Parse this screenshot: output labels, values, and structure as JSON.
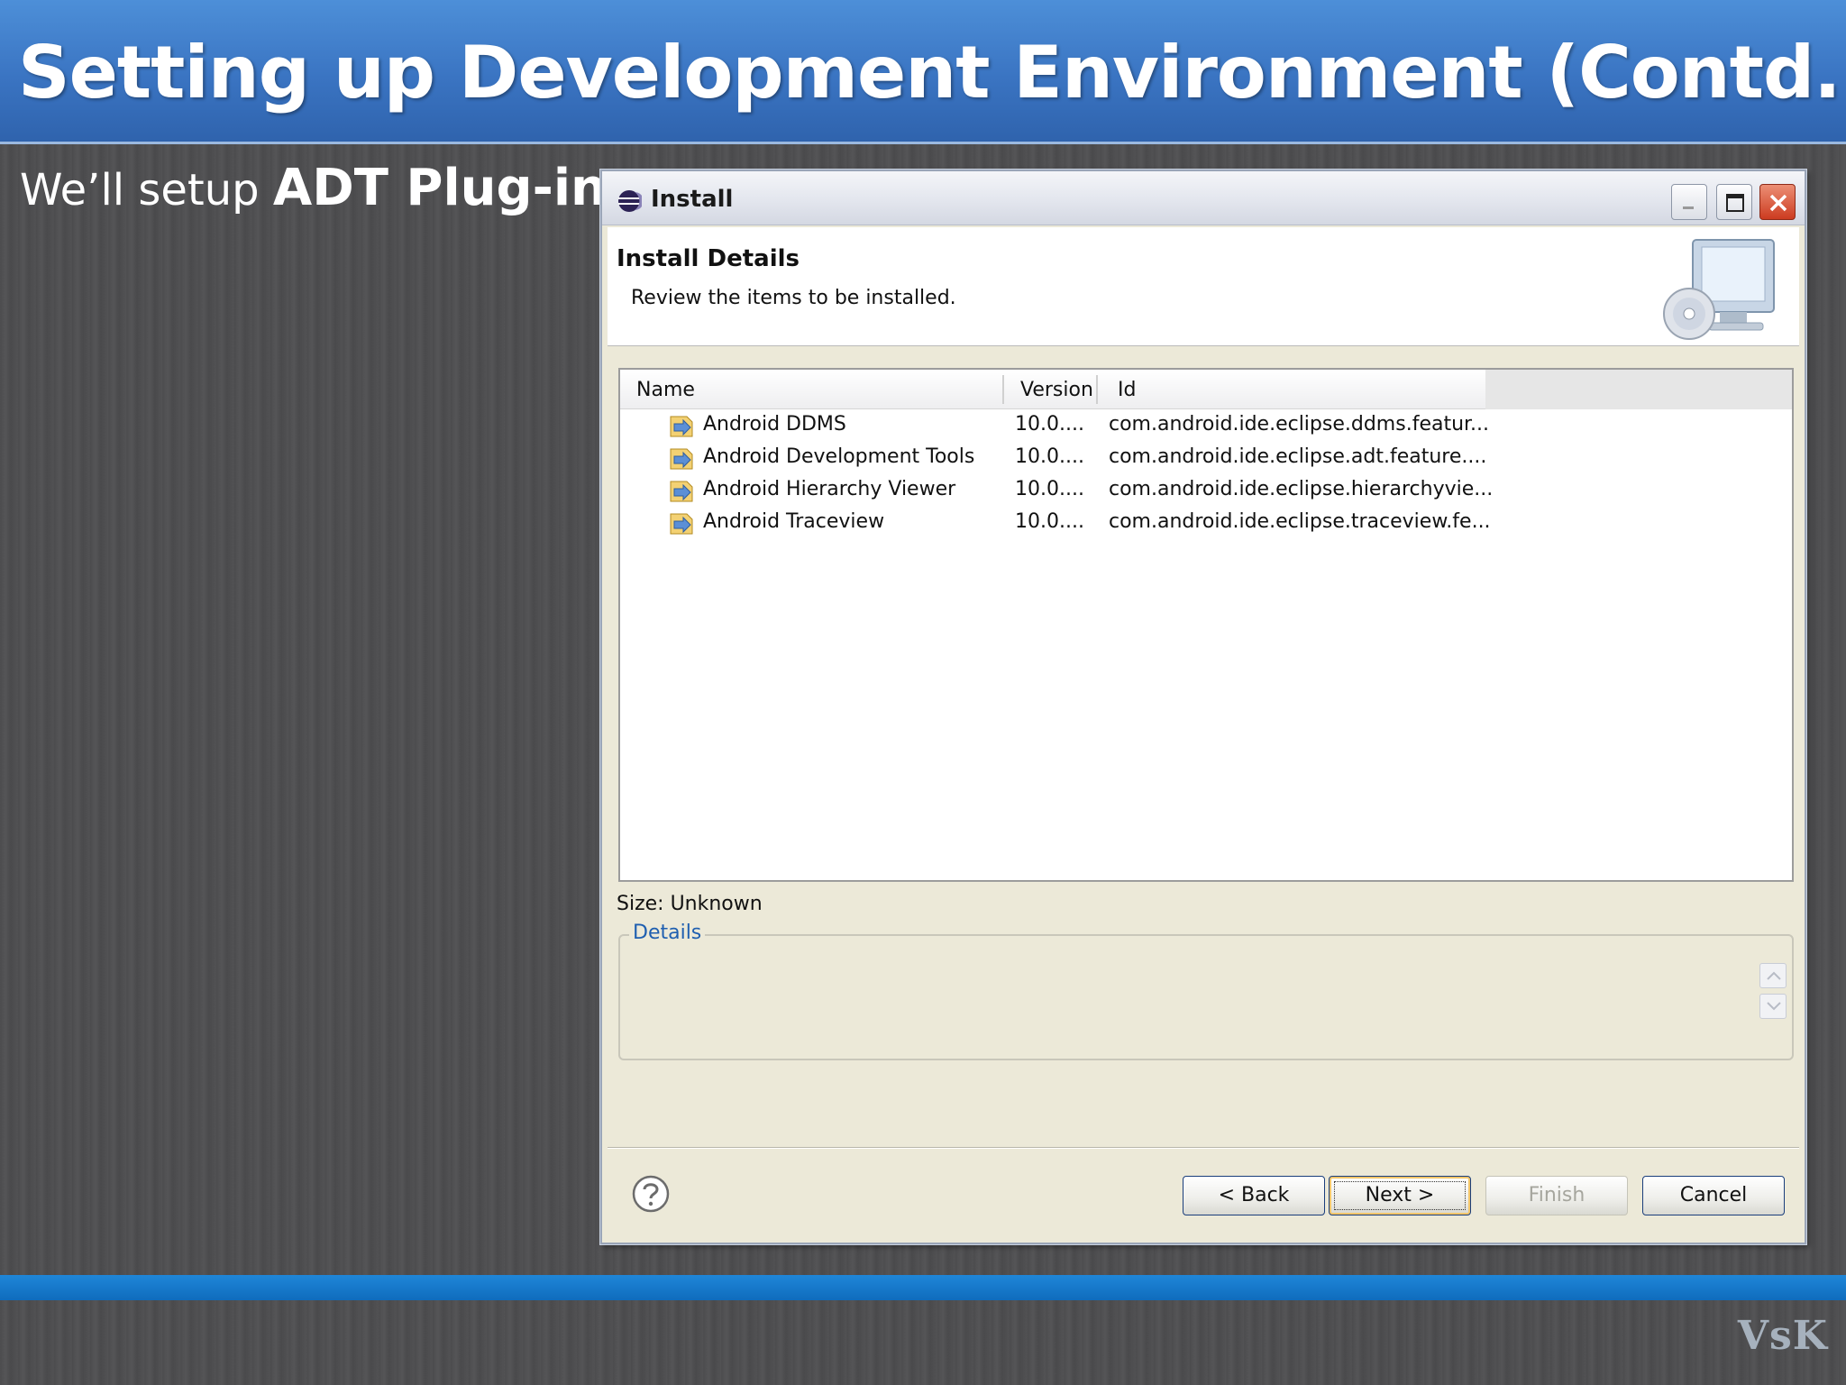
{
  "slide": {
    "title": "Setting up Development Environment (Contd.)",
    "subtitle_prefix": "We’ll setup ",
    "subtitle_bold": "ADT Plug-in",
    "watermark": "VsK"
  },
  "window": {
    "title": "Install",
    "header": {
      "heading": "Install Details",
      "description": "Review the items to be installed."
    },
    "table": {
      "columns": [
        "Name",
        "Version",
        "Id"
      ],
      "rows": [
        {
          "name": "Android DDMS",
          "version": "10.0....",
          "id": "com.android.ide.eclipse.ddms.featur..."
        },
        {
          "name": "Android Development Tools",
          "version": "10.0....",
          "id": "com.android.ide.eclipse.adt.feature...."
        },
        {
          "name": "Android Hierarchy Viewer",
          "version": "10.0....",
          "id": "com.android.ide.eclipse.hierarchyvie..."
        },
        {
          "name": "Android Traceview",
          "version": "10.0....",
          "id": "com.android.ide.eclipse.traceview.fe..."
        }
      ]
    },
    "size_label": "Size: Unknown",
    "details_label": "Details",
    "buttons": {
      "back": "< Back",
      "next": "Next >",
      "finish": "Finish",
      "cancel": "Cancel"
    }
  },
  "colors": {
    "header_blue": "#3a74c2",
    "bottom_bar": "#1f86d8",
    "dialog_bg": "#ece9d8",
    "details_legend": "#1f5fb0"
  },
  "icons": {
    "title": "eclipse-icon",
    "header": "monitor-cd-icon",
    "feature": "feature-plugin-icon",
    "help": "help-icon"
  }
}
